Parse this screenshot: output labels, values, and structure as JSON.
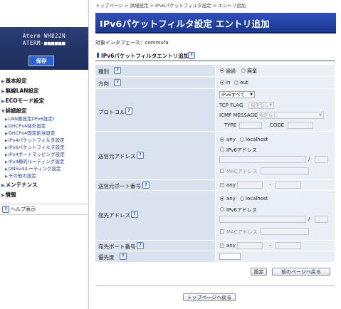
{
  "sidebar": {
    "model": "Aterm WH822N",
    "device": "ATERM-■■■■■■",
    "save_label": "保存",
    "nav": [
      {
        "label": "基本設定",
        "type": "main"
      },
      {
        "label": "無線LAN設定",
        "type": "main"
      },
      {
        "label": "ECOモード設定",
        "type": "main"
      },
      {
        "label": "詳細設定",
        "type": "main"
      },
      {
        "label": "LAN側設定(IPv6設定)",
        "type": "sub"
      },
      {
        "label": "DHCPv4除外設定",
        "type": "sub"
      },
      {
        "label": "DHCPv4固定割当設定",
        "type": "sub"
      },
      {
        "label": "IPv4パケットフィルタ設定",
        "type": "sub"
      },
      {
        "label": "IPv6パケットフィルタ設定",
        "type": "sub"
      },
      {
        "label": "IPv4ポートマッピング設定",
        "type": "sub"
      },
      {
        "label": "IPv4静的ルーティング設定",
        "type": "sub"
      },
      {
        "label": "DNSv4ルーティング設定",
        "type": "sub"
      },
      {
        "label": "その他の設定",
        "type": "sub"
      },
      {
        "label": "メンテナンス",
        "type": "main"
      },
      {
        "label": "情報",
        "type": "main"
      }
    ],
    "help_label": "ヘルプ表示"
  },
  "breadcrumb": "トップページ > 詳細設定 > IPv6パケットフィルタ設定 > エントリ追加",
  "page_title": "IPv6パケットフィルタ設定 エントリ追加",
  "interface": "対象インタフェース：commufa",
  "section_title": "IPv6パケットフィルタエントリ追加",
  "form": {
    "kind": {
      "label": "種別",
      "opt1": "通過",
      "opt2": "廃棄",
      "selected": "通過"
    },
    "direction": {
      "label": "方向",
      "opt1": "in",
      "opt2": "out",
      "selected": "in"
    },
    "protocol": {
      "label": "プロトコル",
      "select_value": "IPv6すべて",
      "tcp_flag_label": "TCP FLAG",
      "tcp_flag_value": "指定なし",
      "icmp_label": "ICMP MESSAGE",
      "icmp_value": "指定なし",
      "type_label": "TYPE",
      "code_label": "CODE"
    },
    "src_addr": {
      "label": "送信元アドレス",
      "opt_any": "any",
      "opt_localhost": "localhost",
      "opt_ipv6": "IPv6アドレス",
      "slash": "/",
      "mac_label": "MACアドレス"
    },
    "src_port": {
      "label": "送信元ポート番号",
      "any_label": "any",
      "dash": "-"
    },
    "dst_addr": {
      "label": "宛先アドレス",
      "opt_any": "any",
      "opt_localhost": "localhost",
      "opt_ipv6": "IPv6アドレス",
      "slash": "/",
      "mac_label": "MACアドレス"
    },
    "dst_port": {
      "label": "宛先ポート番号",
      "any_label": "any",
      "dash": "-"
    },
    "priority": {
      "label": "優先度",
      "value": ""
    }
  },
  "buttons": {
    "set": "設定",
    "back": "前のページへ戻る",
    "top": "トップページへ戻る"
  },
  "help_glyph": "?",
  "check_glyph": "✓"
}
